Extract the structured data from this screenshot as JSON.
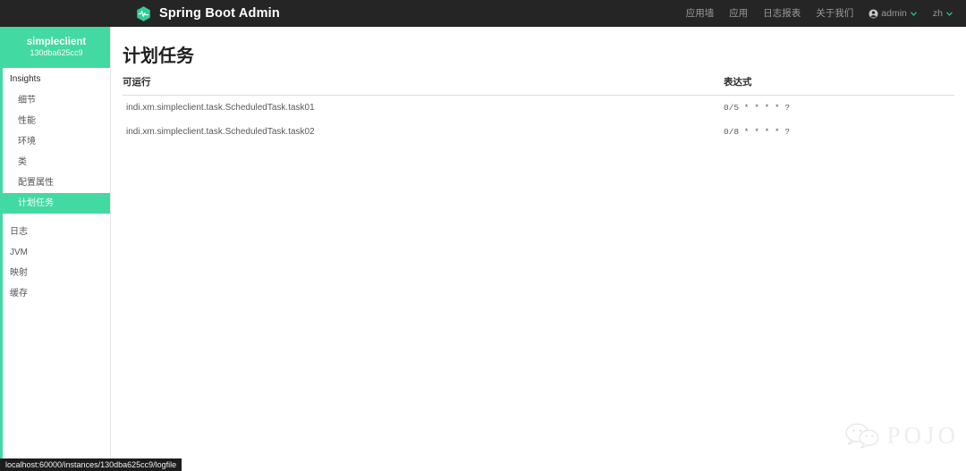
{
  "navbar": {
    "brand": "Spring Boot Admin",
    "brand_logo_icon": "spring-boot-admin-pulse-hexagon-icon",
    "links": [
      {
        "label": "应用墙"
      },
      {
        "label": "应用"
      },
      {
        "label": "日志报表"
      },
      {
        "label": "关于我们"
      }
    ],
    "user": {
      "label": "admin",
      "icon": "user-circle-icon",
      "caret_icon": "chevron-down-icon"
    },
    "language": {
      "label": "zh",
      "caret_icon": "chevron-down-icon"
    },
    "background_color": "#252525",
    "accent_color": "#43d9a3"
  },
  "sidebar": {
    "app_name": "simpleclient",
    "instance_id": "130dba625cc9",
    "section_label": "Insights",
    "insight_items": [
      {
        "label": "细节",
        "active": false
      },
      {
        "label": "性能",
        "active": false
      },
      {
        "label": "环境",
        "active": false
      },
      {
        "label": "类",
        "active": false
      },
      {
        "label": "配置属性",
        "active": false
      },
      {
        "label": "计划任务",
        "active": true
      }
    ],
    "bottom_items": [
      {
        "label": "日志"
      },
      {
        "label": "JVM"
      },
      {
        "label": "映射"
      },
      {
        "label": "缓存"
      }
    ],
    "header_color": "#43d9a3",
    "active_color": "#43d9a3"
  },
  "main": {
    "title": "计划任务",
    "table": {
      "columns": [
        "可运行",
        "表达式"
      ],
      "rows": [
        {
          "runnable": "indi.xm.simpleclient.task.ScheduledTask.task01",
          "expression": "0/5 * * * * ?"
        },
        {
          "runnable": "indi.xm.simpleclient.task.ScheduledTask.task02",
          "expression": "0/8 * * * * ?"
        }
      ]
    }
  },
  "watermark": {
    "text": "POJO",
    "icon": "wechat-bubbles-icon"
  },
  "statusbar": {
    "url": "localhost:60000/instances/130dba625cc9/logfile"
  }
}
